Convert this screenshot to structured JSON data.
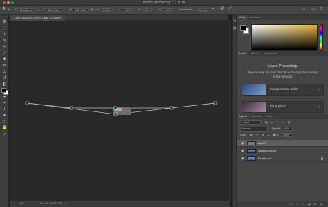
{
  "app_title": "Adobe Photoshop CC 2018",
  "options": {
    "x": "4749.12 px",
    "y": "1918.69 px",
    "w": "1977.88%",
    "h": "90.79%",
    "angle": "0.00",
    "h_skew": "0.00",
    "v_skew": "0.00",
    "interpolation_label": "Interpolation:",
    "interpolation_value": "Bicubic"
  },
  "document": {
    "tab": "IMG_6428.CR2 @ 2% (Layer 2, RGB/8*)",
    "status_zoom": "2%",
    "status_doc": "Doc: 68.7M/137.3M"
  },
  "color_panel": {
    "tabs": [
      "Color",
      "Swatches"
    ],
    "foreground": "#000000",
    "background": "#ffffff",
    "hue_color": "#e5b13a"
  },
  "learn_panel": {
    "tabs": [
      "Learn",
      "Libraries",
      "Adjustments"
    ],
    "title": "Learn Photoshop",
    "subtitle": "Step-by-step tutorials directly in the app. Pick a topic below to begin.",
    "cards": [
      {
        "label": "Fundamental Skills"
      },
      {
        "label": "Fix a photo"
      }
    ]
  },
  "layers_panel": {
    "tabs": [
      "Layers",
      "Channels",
      "Paths"
    ],
    "blend_mode": "Normal",
    "opacity_label": "Opacity:",
    "opacity_value": "100%",
    "fill_label": "Fill:",
    "fill_value": "100%",
    "lock_label": "Lock:",
    "layers": [
      {
        "name": "Layer 2"
      },
      {
        "name": "Background copy"
      },
      {
        "name": "Background"
      }
    ],
    "footer_icons": "fx ◐ ▭ ▣ ⊞ ▤"
  }
}
